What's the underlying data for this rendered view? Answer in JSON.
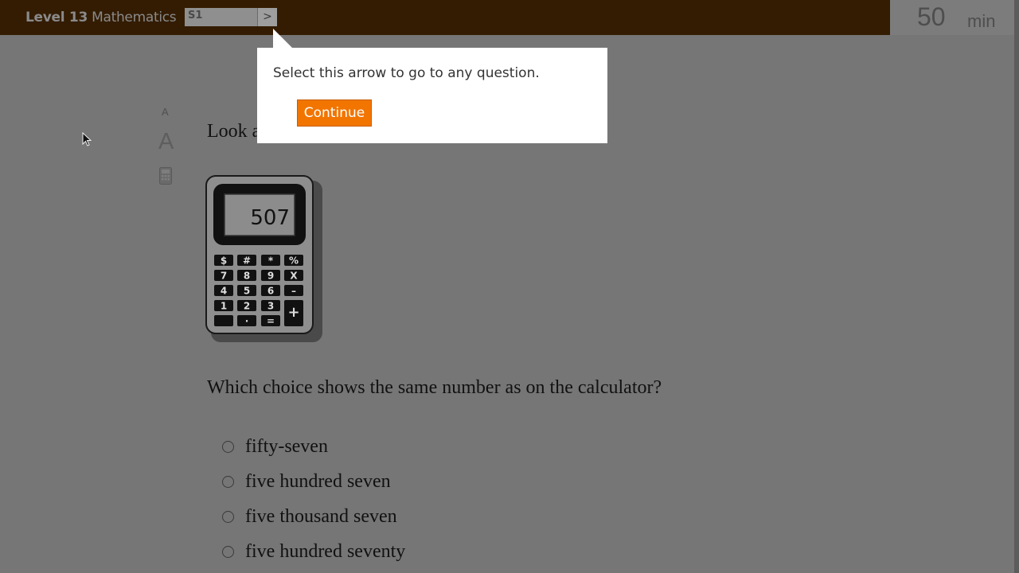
{
  "header": {
    "level": "Level 13",
    "subject": "Mathematics",
    "question_selector": "S1",
    "next_arrow_icon": "chevron-right-icon",
    "timer_value": "50",
    "timer_unit": "min"
  },
  "tools": {
    "small_text": "A",
    "large_text": "A",
    "calculator_icon": "calculator-icon"
  },
  "question": {
    "intro_visible": "Look a",
    "calculator_display": "507",
    "calculator_keys": [
      "$",
      "#",
      "*",
      "%",
      "7",
      "8",
      "9",
      "X",
      "4",
      "5",
      "6",
      "–",
      "1",
      "2",
      "3",
      "+",
      "",
      "·",
      "="
    ],
    "prompt": "Which choice shows the same number as on the calculator?",
    "choices": [
      "fifty-seven",
      "five hundred seven",
      "five thousand seven",
      "five hundred seventy"
    ]
  },
  "tooltip": {
    "message": "Select this arrow to go to any question.",
    "button_label": "Continue"
  },
  "colors": {
    "topbar": "#331c02",
    "overlay": "#767676",
    "accent": "#f27500"
  }
}
